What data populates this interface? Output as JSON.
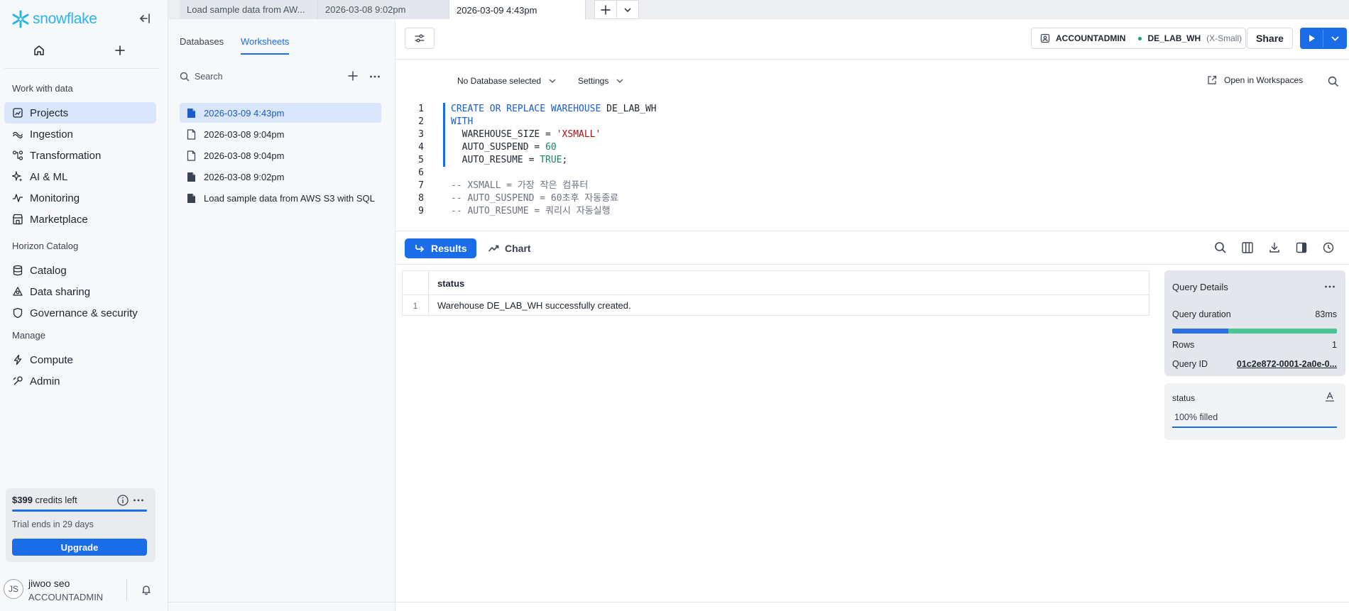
{
  "brand": {
    "logo_text": "snowflake",
    "accent": "#1a6ce7",
    "logo_color": "#29b5e8"
  },
  "nav": {
    "sections": [
      {
        "title": "Work with data",
        "items": [
          {
            "label": "Projects",
            "icon": "projects-icon",
            "active": true
          },
          {
            "label": "Ingestion",
            "icon": "ingestion-icon"
          },
          {
            "label": "Transformation",
            "icon": "transformation-icon"
          },
          {
            "label": "AI & ML",
            "icon": "sparkle-icon"
          },
          {
            "label": "Monitoring",
            "icon": "monitoring-icon"
          },
          {
            "label": "Marketplace",
            "icon": "marketplace-icon"
          }
        ]
      },
      {
        "title": "Horizon Catalog",
        "items": [
          {
            "label": "Catalog",
            "icon": "catalog-icon"
          },
          {
            "label": "Data sharing",
            "icon": "data-sharing-icon"
          },
          {
            "label": "Governance & security",
            "icon": "shield-icon"
          }
        ]
      },
      {
        "title": "Manage",
        "items": [
          {
            "label": "Compute",
            "icon": "bolt-icon"
          },
          {
            "label": "Admin",
            "icon": "admin-icon"
          }
        ]
      }
    ]
  },
  "credits": {
    "amount": "$399",
    "suffix": " credits left",
    "trial": "Trial ends in 29 days",
    "upgrade": "Upgrade"
  },
  "user": {
    "initials": "JS",
    "name": "jiwoo seo",
    "role": "ACCOUNTADMIN"
  },
  "tabs": [
    {
      "label": "Load sample data from AW...",
      "active": false
    },
    {
      "label": "2026-03-08 9:02pm",
      "active": false
    },
    {
      "label": "2026-03-09 4:43pm",
      "active": true
    }
  ],
  "ws_panel": {
    "tabs": [
      "Databases",
      "Worksheets"
    ],
    "active_tab": "Worksheets",
    "search_placeholder": "Search",
    "items": [
      {
        "label": "2026-03-09 4:43pm",
        "active": true,
        "filled": true
      },
      {
        "label": "2026-03-08 9:04pm",
        "filled": false
      },
      {
        "label": "2026-03-08 9:04pm",
        "filled": false
      },
      {
        "label": "2026-03-08 9:02pm",
        "filled": true
      },
      {
        "label": "Load sample data from AWS S3 with SQL",
        "filled": true
      }
    ]
  },
  "toolbar": {
    "role": "ACCOUNTADMIN",
    "warehouse": "DE_LAB_WH",
    "warehouse_size": "(X-Small)",
    "share": "Share"
  },
  "context": {
    "database": "No Database selected",
    "settings": "Settings",
    "open_in": "Open in Workspaces"
  },
  "code": {
    "lines": [
      {
        "n": "1",
        "tokens": [
          [
            "kw",
            "CREATE OR REPLACE "
          ],
          [
            "kw",
            "WAREHOUSE "
          ],
          [
            "plain",
            "DE_LAB_WH"
          ]
        ]
      },
      {
        "n": "2",
        "tokens": [
          [
            "kw",
            "WITH"
          ]
        ]
      },
      {
        "n": "3",
        "tokens": [
          [
            "plain",
            "  WAREHOUSE_SIZE = "
          ],
          [
            "str",
            "'XSMALL'"
          ]
        ]
      },
      {
        "n": "4",
        "tokens": [
          [
            "plain",
            "  AUTO_SUSPEND = "
          ],
          [
            "num",
            "60"
          ]
        ]
      },
      {
        "n": "5",
        "tokens": [
          [
            "plain",
            "  AUTO_RESUME = "
          ],
          [
            "num",
            "TRUE"
          ],
          [
            "plain",
            ";"
          ]
        ]
      },
      {
        "n": "6",
        "tokens": []
      },
      {
        "n": "7",
        "tokens": [
          [
            "cmt",
            "-- XSMALL = 가장 작은 컴퓨터"
          ]
        ]
      },
      {
        "n": "8",
        "tokens": [
          [
            "cmt",
            "-- AUTO_SUSPEND = 60초후 자동종료"
          ]
        ]
      },
      {
        "n": "9",
        "tokens": [
          [
            "cmt",
            "-- AUTO_RESUME = 쿼리시 자동실행"
          ]
        ]
      }
    ]
  },
  "results": {
    "tabs": {
      "results": "Results",
      "chart": "Chart"
    },
    "column": "status",
    "rows": [
      {
        "n": "1",
        "status": "Warehouse DE_LAB_WH successfully created."
      }
    ]
  },
  "query_details": {
    "title": "Query Details",
    "duration_label": "Query duration",
    "duration": "83ms",
    "duration_split_fraction": 0.34,
    "rows_label": "Rows",
    "rows": "1",
    "id_label": "Query ID",
    "id": "01c2e872-0001-2a0e-0..."
  },
  "column_stats": {
    "title": "status",
    "value": "100% filled"
  }
}
